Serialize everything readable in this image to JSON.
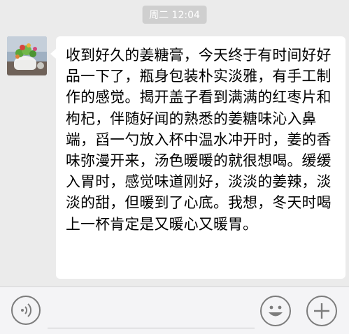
{
  "header": {
    "timestamp": "周二 12:04"
  },
  "message": {
    "sender_avatar_icon": "potted-plant-avatar",
    "text": "收到好久的姜糖膏，今天终于有时间好好品一下了，瓶身包装朴实淡雅，有手工制作的感觉。揭开盖子看到满满的红枣片和枸杞，伴随好闻的熟悉的姜糖味沁入鼻端，舀一勺放入杯中温水冲开时，姜的香味弥漫开来，汤色暖暖的就很想喝。缓缓入胃时，感觉味道刚好，淡淡的姜辣，淡淡的甜，但暖到了心底。我想，冬天时喝上一杯肯定是又暖心又暖胃。"
  },
  "input_bar": {
    "voice_icon": "voice-icon",
    "emoji_icon": "smiley-icon",
    "add_icon": "plus-icon",
    "text_value": ""
  },
  "colors": {
    "background": "#ebebeb",
    "bubble": "#ffffff",
    "timestamp_bg": "#cfcfcf",
    "toolbar_bg": "#f4f4f6",
    "icon_stroke": "#7c7c7c"
  }
}
